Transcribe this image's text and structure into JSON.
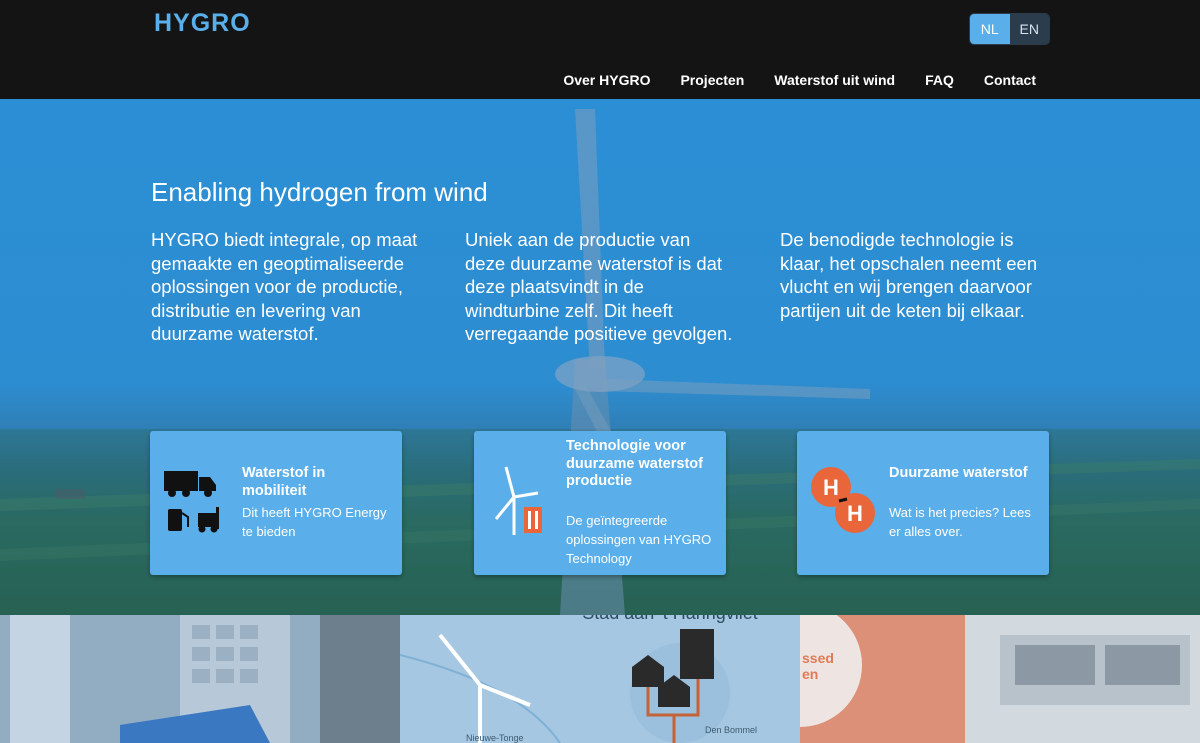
{
  "header": {
    "logo": "HYGRO",
    "languages": [
      "NL",
      "EN"
    ],
    "active_language": "NL",
    "nav": [
      "Over HYGRO",
      "Projecten",
      "Waterstof uit wind",
      "FAQ",
      "Contact"
    ]
  },
  "hero": {
    "title": "Enabling hydrogen from wind",
    "columns": [
      "HYGRO biedt integrale, op maat gemaakte en geoptimaliseerde oplossingen voor de productie, distributie en levering van duurzame waterstof.",
      "Uniek aan de productie van deze duurzame waterstof is dat deze plaatsvindt in de windturbine zelf. Dit heeft verregaande positieve gevolgen.",
      "De benodigde technologie is klaar, het opschalen neemt een vlucht en wij brengen daarvoor partijen uit de keten bij elkaar."
    ]
  },
  "cards": [
    {
      "title": "Waterstof in mobiliteit",
      "text": "Dit heeft HYGRO Energy te bieden",
      "icon": "truck-fuel-icon"
    },
    {
      "title": "Technologie voor duurzame waterstof productie",
      "text": "De geïntegreerde oplossingen van HYGRO Technology",
      "icon": "wind-turbine-icon"
    },
    {
      "title": "Duurzame waterstof",
      "text": "Wat is het precies? Lees er alles over.",
      "icon": "hydrogen-molecule-icon",
      "icon_letter": "H"
    }
  ],
  "tiles": {
    "map_title": "Stad aan 't Haringvliet",
    "map_label_1": "Nieuwe-Tonge",
    "map_label_2": "Den Bommel",
    "truck_text": "ssed\nen"
  },
  "colors": {
    "accent": "#5aaee9",
    "header_bg": "#141414",
    "h2_orange": "#e8663a"
  }
}
